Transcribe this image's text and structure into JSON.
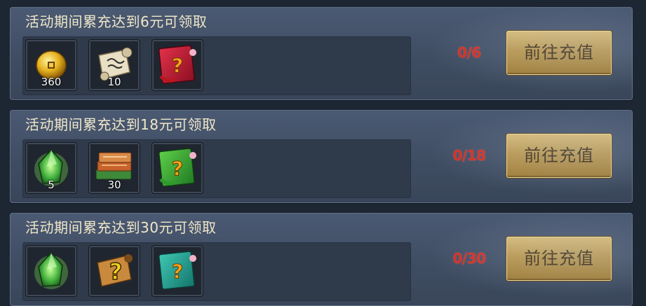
{
  "colors": {
    "panel": "#3f4d63",
    "progress_text": "#d42b1f",
    "title_text": "#f0e7c9",
    "button_gold": "#bb9648"
  },
  "tiers": [
    {
      "title": "活动期间累充达到6元可领取",
      "progress": "0/6",
      "button_label": "前往充值",
      "items": [
        {
          "icon": "gold-coin-icon",
          "count": "360"
        },
        {
          "icon": "scroll-icon",
          "count": "10"
        },
        {
          "icon": "red-mystery-book-icon",
          "count": ""
        }
      ]
    },
    {
      "title": "活动期间累充达到18元可领取",
      "progress": "0/18",
      "button_label": "前往充值",
      "items": [
        {
          "icon": "green-gem-icon",
          "count": "5"
        },
        {
          "icon": "book-stack-icon",
          "count": "30"
        },
        {
          "icon": "green-mystery-book-icon",
          "count": ""
        }
      ]
    },
    {
      "title": "活动期间累充达到30元可领取",
      "progress": "0/30",
      "button_label": "前往充值",
      "items": [
        {
          "icon": "green-gem-icon",
          "count": ""
        },
        {
          "icon": "mystery-scroll-icon",
          "count": ""
        },
        {
          "icon": "teal-mystery-book-icon",
          "count": ""
        }
      ]
    }
  ]
}
